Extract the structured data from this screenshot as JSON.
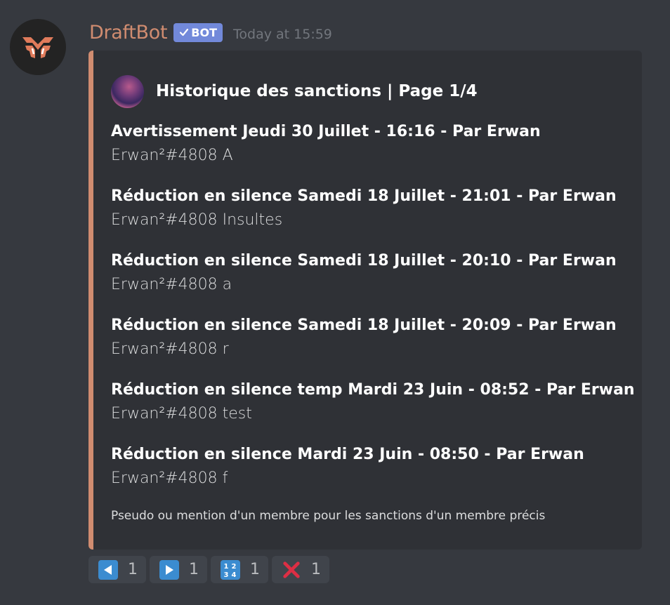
{
  "message": {
    "username": "DraftBot",
    "bot_tag": "BOT",
    "timestamp": "Today at 15:59",
    "avatar_icon": "draftbot-logo-icon"
  },
  "embed": {
    "accent_color": "#d08c70",
    "author": {
      "icon": "galaxy-avatar-icon",
      "name": "Historique des sanctions | Page 1/4"
    },
    "fields": [
      {
        "name": "Avertissement Jeudi 30 Juillet - 16:16 - Par Erwan",
        "value": "Erwan²#4808 A"
      },
      {
        "name": "Réduction en silence Samedi 18 Juillet - 21:01 - Par Erwan",
        "value": "Erwan²#4808 Insultes"
      },
      {
        "name": "Réduction en silence Samedi 18 Juillet - 20:10 - Par Erwan",
        "value": "Erwan²#4808 a"
      },
      {
        "name": "Réduction en silence Samedi 18 Juillet - 20:09 - Par Erwan",
        "value": "Erwan²#4808 r"
      },
      {
        "name": "Réduction en silence temp Mardi 23 Juin - 08:52 - Par Erwan",
        "value": "Erwan²#4808 test"
      },
      {
        "name": "Réduction en silence Mardi 23 Juin - 08:50 - Par Erwan",
        "value": "Erwan²#4808 f"
      }
    ],
    "footer": "Pseudo ou mention d'un membre pour les sanctions d'un membre précis"
  },
  "reactions": [
    {
      "emoji": "arrow-backward-icon",
      "count": "1"
    },
    {
      "emoji": "arrow-forward-icon",
      "count": "1"
    },
    {
      "emoji": "1234-numbers-icon",
      "count": "1",
      "label": "1234"
    },
    {
      "emoji": "red-x-icon",
      "count": "1"
    }
  ]
}
